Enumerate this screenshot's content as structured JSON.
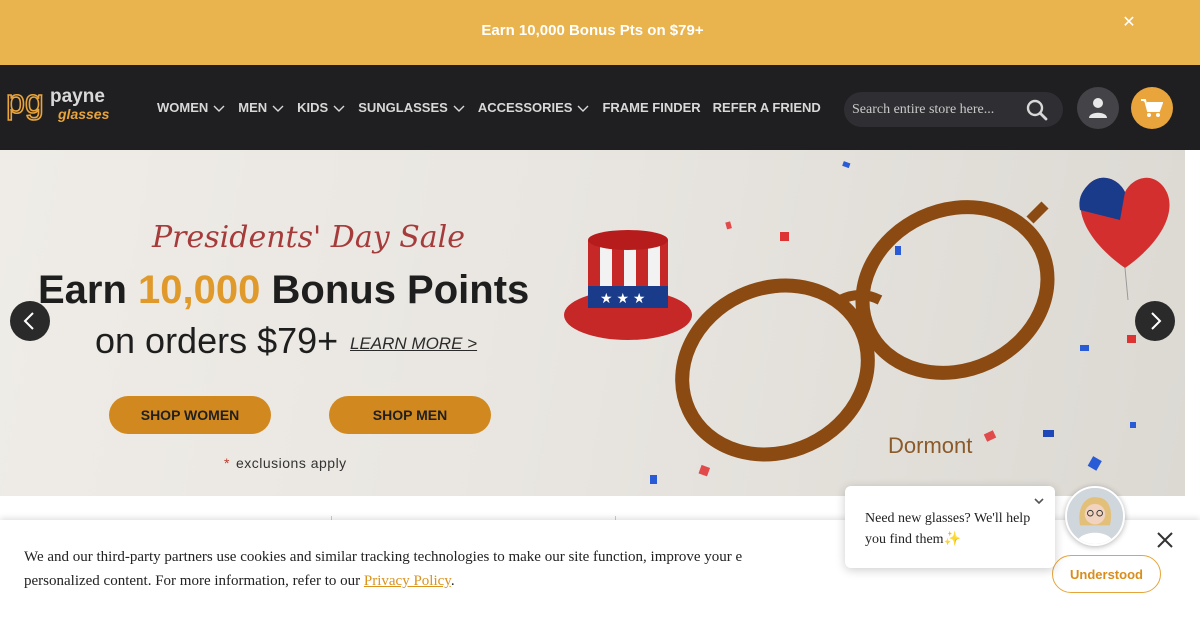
{
  "promo": {
    "text": "Earn 10,000 Bonus Pts on $79+",
    "close_icon": "close-icon"
  },
  "header": {
    "logo": {
      "primary": "payne",
      "secondary": "glasses",
      "mark": "pg"
    },
    "nav": [
      {
        "label": "WOMEN",
        "has_dropdown": true
      },
      {
        "label": "MEN",
        "has_dropdown": true
      },
      {
        "label": "KIDS",
        "has_dropdown": true
      },
      {
        "label": "SUNGLASSES",
        "has_dropdown": true
      },
      {
        "label": "ACCESSORIES",
        "has_dropdown": true
      },
      {
        "label": "FRAME FINDER",
        "has_dropdown": false
      },
      {
        "label": "REFER A FRIEND",
        "has_dropdown": false
      }
    ],
    "search": {
      "placeholder": "Search entire store here..."
    },
    "icons": {
      "account": "user-icon",
      "cart": "cart-icon",
      "search": "search-icon"
    }
  },
  "hero": {
    "script_title": "Presidents' Day Sale",
    "headline_prefix": "Earn ",
    "headline_accent": "10,000",
    "headline_suffix": " Bonus Points",
    "subline": "on orders $79+",
    "learn_more": "LEARN MORE >",
    "shop_women": "SHOP WOMEN",
    "shop_men": "SHOP MEN",
    "exclusions_star": "*",
    "exclusions": "exclusions apply",
    "brand": "Dormont"
  },
  "cookie": {
    "text_before": "We and our third-party partners use cookies and similar tracking technologies to make our site function, improve your e",
    "text_line2": "personalized content. For more information, refer to our ",
    "link": "Privacy Policy",
    "text_after": ".",
    "button": "Understood"
  },
  "chat": {
    "message": "Need new glasses? We'll help you find them✨"
  },
  "colors": {
    "promo": "#e9b34d",
    "header": "#1f1f21",
    "accent": "#e09a2b",
    "button": "#d1891f"
  }
}
